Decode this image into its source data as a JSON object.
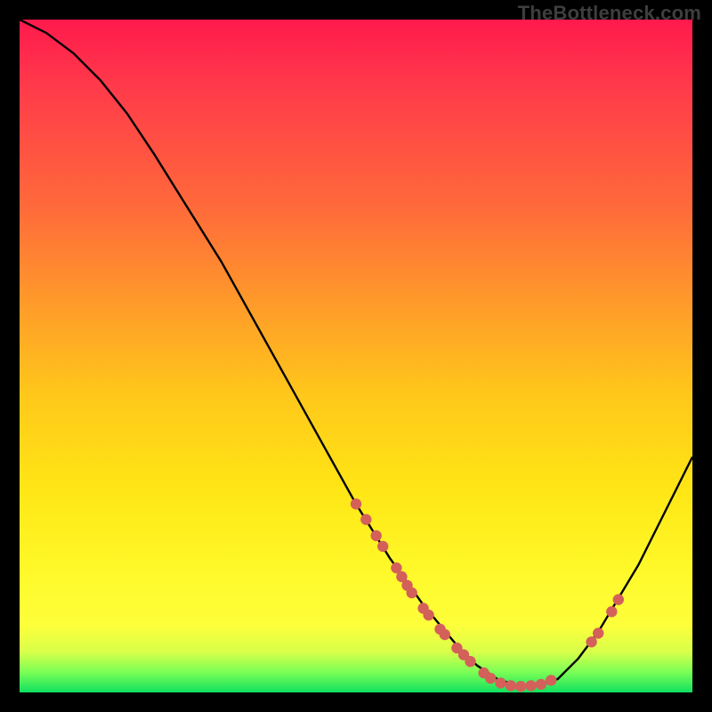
{
  "watermark": "TheBottleneck.com",
  "colors": {
    "background": "#000000",
    "curve_stroke": "#000000",
    "dot_fill": "#d4605a",
    "gradient_top": "#ff1a4d",
    "gradient_bottom": "#10e060"
  },
  "chart_data": {
    "type": "line",
    "title": "",
    "xlabel": "",
    "ylabel": "",
    "xlim": [
      0,
      100
    ],
    "ylim": [
      0,
      100
    ],
    "curve": [
      {
        "x": 0,
        "y": 100
      },
      {
        "x": 4,
        "y": 98
      },
      {
        "x": 8,
        "y": 95
      },
      {
        "x": 12,
        "y": 91
      },
      {
        "x": 16,
        "y": 86
      },
      {
        "x": 20,
        "y": 80
      },
      {
        "x": 25,
        "y": 72
      },
      {
        "x": 30,
        "y": 64
      },
      {
        "x": 35,
        "y": 55
      },
      {
        "x": 40,
        "y": 46
      },
      {
        "x": 45,
        "y": 37
      },
      {
        "x": 50,
        "y": 28
      },
      {
        "x": 55,
        "y": 20
      },
      {
        "x": 60,
        "y": 13
      },
      {
        "x": 65,
        "y": 7
      },
      {
        "x": 68,
        "y": 4
      },
      {
        "x": 71,
        "y": 2
      },
      {
        "x": 74,
        "y": 1
      },
      {
        "x": 77,
        "y": 1
      },
      {
        "x": 80,
        "y": 2
      },
      {
        "x": 83,
        "y": 5
      },
      {
        "x": 86,
        "y": 9
      },
      {
        "x": 89,
        "y": 14
      },
      {
        "x": 92,
        "y": 19
      },
      {
        "x": 95,
        "y": 25
      },
      {
        "x": 98,
        "y": 31
      },
      {
        "x": 100,
        "y": 35
      }
    ],
    "dots": [
      {
        "x": 50.0,
        "y": 28.0
      },
      {
        "x": 51.5,
        "y": 25.7
      },
      {
        "x": 53.0,
        "y": 23.3
      },
      {
        "x": 54.0,
        "y": 21.7
      },
      {
        "x": 56.0,
        "y": 18.5
      },
      {
        "x": 56.8,
        "y": 17.2
      },
      {
        "x": 57.6,
        "y": 15.9
      },
      {
        "x": 58.3,
        "y": 14.8
      },
      {
        "x": 60.0,
        "y": 12.5
      },
      {
        "x": 60.8,
        "y": 11.5
      },
      {
        "x": 62.5,
        "y": 9.4
      },
      {
        "x": 63.2,
        "y": 8.6
      },
      {
        "x": 65.0,
        "y": 6.6
      },
      {
        "x": 66.0,
        "y": 5.6
      },
      {
        "x": 67.0,
        "y": 4.6
      },
      {
        "x": 69.0,
        "y": 2.9
      },
      {
        "x": 70.0,
        "y": 2.1
      },
      {
        "x": 71.5,
        "y": 1.4
      },
      {
        "x": 73.0,
        "y": 1.0
      },
      {
        "x": 74.5,
        "y": 0.9
      },
      {
        "x": 76.0,
        "y": 1.0
      },
      {
        "x": 77.5,
        "y": 1.2
      },
      {
        "x": 79.0,
        "y": 1.8
      },
      {
        "x": 85.0,
        "y": 7.5
      },
      {
        "x": 86.0,
        "y": 8.8
      },
      {
        "x": 88.0,
        "y": 12.0
      },
      {
        "x": 89.0,
        "y": 13.8
      }
    ],
    "annotations": []
  }
}
